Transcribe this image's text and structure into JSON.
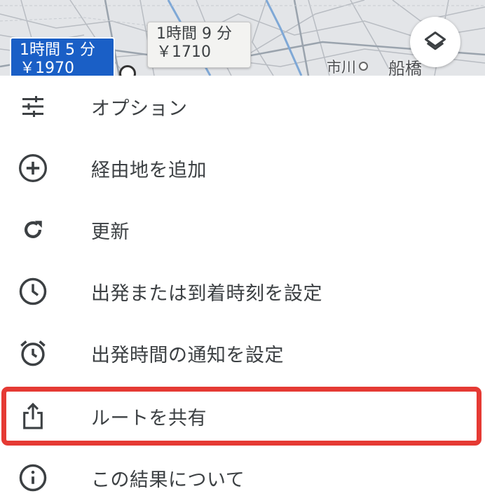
{
  "map": {
    "route_primary": {
      "duration": "1時間 5 分",
      "fare": "￥1970"
    },
    "route_alt": {
      "duration": "1時間 9 分",
      "fare": "￥1710"
    },
    "places": {
      "ichikawa": "市川",
      "funabashi": "船橋"
    },
    "layers_icon": "layers-icon"
  },
  "menu": {
    "items": [
      {
        "label": "オプション",
        "icon": "tune-icon"
      },
      {
        "label": "経由地を追加",
        "icon": "add-circle-icon"
      },
      {
        "label": "更新",
        "icon": "refresh-icon"
      },
      {
        "label": "出発または到着時刻を設定",
        "icon": "clock-icon"
      },
      {
        "label": "出発時間の通知を設定",
        "icon": "alarm-icon"
      },
      {
        "label": "ルートを共有",
        "icon": "share-icon"
      },
      {
        "label": "この結果について",
        "icon": "info-icon"
      }
    ],
    "highlighted_item": "ルートを共有",
    "highlight_color": "#e53a34"
  },
  "colors": {
    "primary_route": "#1a5fc6",
    "icon": "#3c4043",
    "text": "#3c4043"
  }
}
